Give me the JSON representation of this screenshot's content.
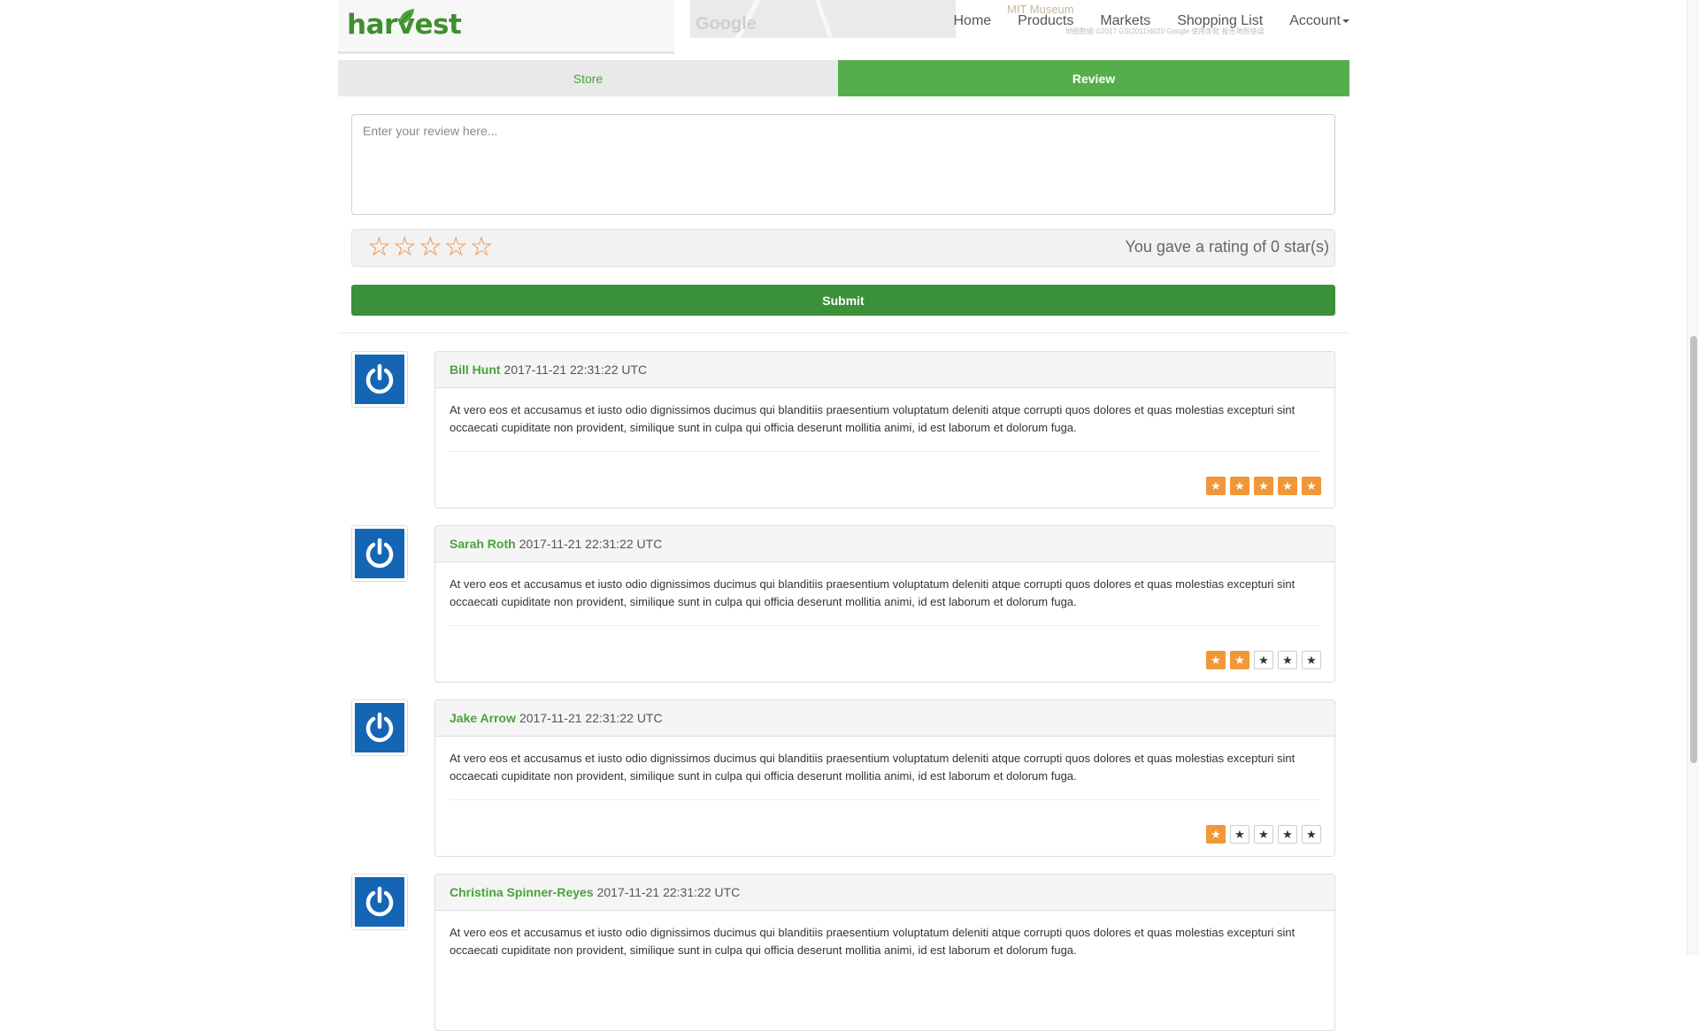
{
  "brand": {
    "logo_text": "harvest"
  },
  "map": {
    "watermark": "Google",
    "label": "MIT Museum",
    "copyright": "地图数据 ©2017 GS(2011)6020 Google 使用条款 报告地图错误"
  },
  "nav": {
    "items": [
      "Home",
      "Products",
      "Markets",
      "Shopping List"
    ],
    "account": "Account"
  },
  "tabs": [
    {
      "label": "Store",
      "active": false
    },
    {
      "label": "Review",
      "active": true
    }
  ],
  "review_form": {
    "placeholder": "Enter your review here...",
    "value": "",
    "rating_text": "You gave a rating of 0 star(s)",
    "rating": 0,
    "max_rating": 5,
    "submit_label": "Submit"
  },
  "colors": {
    "brand_green": "#3b913a",
    "tab_green": "#56ae4b",
    "star_orange": "#f0973a",
    "avatar_blue": "#1466b5"
  },
  "icons": {
    "avatar": "power-icon",
    "star": "star-icon"
  },
  "reviews": [
    {
      "name": "Bill Hunt",
      "date": "2017-11-21 22:31:22 UTC",
      "text": "At vero eos et accusamus et iusto odio dignissimos ducimus qui blanditiis praesentium voluptatum deleniti atque corrupti quos dolores et quas molestias excepturi sint occaecati cupiditate non provident, similique sunt in culpa qui officia deserunt mollitia animi, id est laborum et dolorum fuga.",
      "rating": 5
    },
    {
      "name": "Sarah Roth",
      "date": "2017-11-21 22:31:22 UTC",
      "text": "At vero eos et accusamus et iusto odio dignissimos ducimus qui blanditiis praesentium voluptatum deleniti atque corrupti quos dolores et quas molestias excepturi sint occaecati cupiditate non provident, similique sunt in culpa qui officia deserunt mollitia animi, id est laborum et dolorum fuga.",
      "rating": 2
    },
    {
      "name": "Jake Arrow",
      "date": "2017-11-21 22:31:22 UTC",
      "text": "At vero eos et accusamus et iusto odio dignissimos ducimus qui blanditiis praesentium voluptatum deleniti atque corrupti quos dolores et quas molestias excepturi sint occaecati cupiditate non provident, similique sunt in culpa qui officia deserunt mollitia animi, id est laborum et dolorum fuga.",
      "rating": 1
    },
    {
      "name": "Christina Spinner-Reyes",
      "date": "2017-11-21 22:31:22 UTC",
      "text": "At vero eos et accusamus et iusto odio dignissimos ducimus qui blanditiis praesentium voluptatum deleniti atque corrupti quos dolores et quas molestias excepturi sint occaecati cupiditate non provident, similique sunt in culpa qui officia deserunt mollitia animi, id est laborum et dolorum fuga.",
      "rating": 0
    }
  ]
}
